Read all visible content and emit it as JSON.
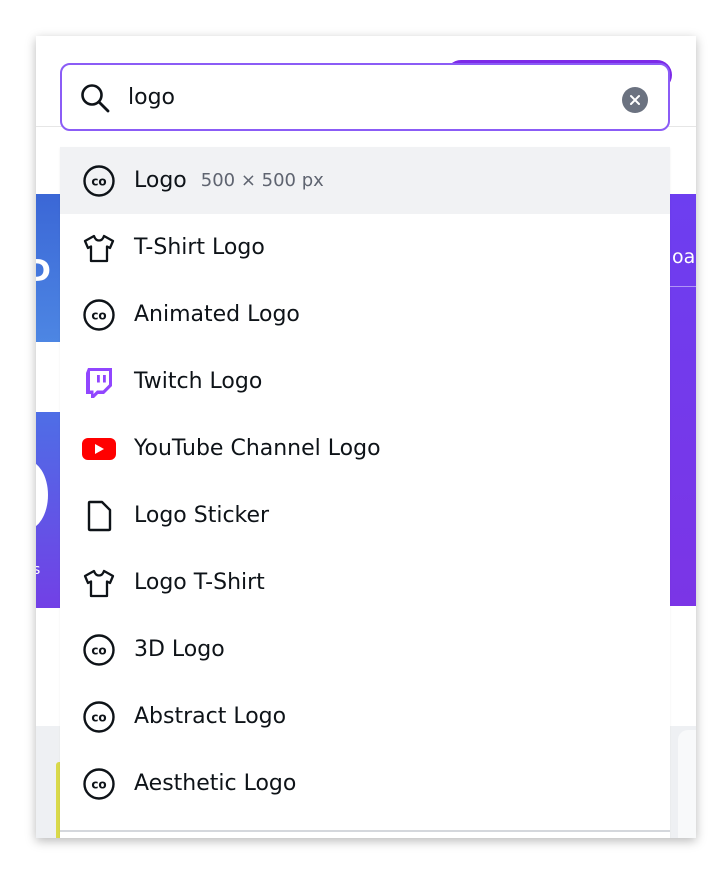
{
  "search": {
    "value": "logo",
    "clear_label": "×"
  },
  "suggestions": [
    {
      "label": "Logo",
      "meta": "500 × 500 px",
      "icon": "canva-doc-icon"
    },
    {
      "label": "T-Shirt Logo",
      "meta": "",
      "icon": "tshirt-icon"
    },
    {
      "label": "Animated Logo",
      "meta": "",
      "icon": "canva-doc-icon"
    },
    {
      "label": "Twitch Logo",
      "meta": "",
      "icon": "twitch-icon"
    },
    {
      "label": "YouTube Channel Logo",
      "meta": "",
      "icon": "youtube-icon"
    },
    {
      "label": "Logo Sticker",
      "meta": "",
      "icon": "file-icon"
    },
    {
      "label": "Logo T-Shirt",
      "meta": "",
      "icon": "tshirt-icon"
    },
    {
      "label": "3D Logo",
      "meta": "",
      "icon": "canva-doc-icon"
    },
    {
      "label": "Abstract Logo",
      "meta": "",
      "icon": "canva-doc-icon"
    },
    {
      "label": "Aesthetic Logo",
      "meta": "",
      "icon": "canva-doc-icon"
    }
  ],
  "background": {
    "card_left_text": "D",
    "card_right_text": "oa",
    "card_left2_text": "s"
  },
  "colors": {
    "accent": "#8b5cf6",
    "twitch": "#9146ff",
    "youtube": "#ff0000",
    "highlight": "#f1f2f4",
    "text": "#0e1318",
    "muted": "#5f6470"
  }
}
